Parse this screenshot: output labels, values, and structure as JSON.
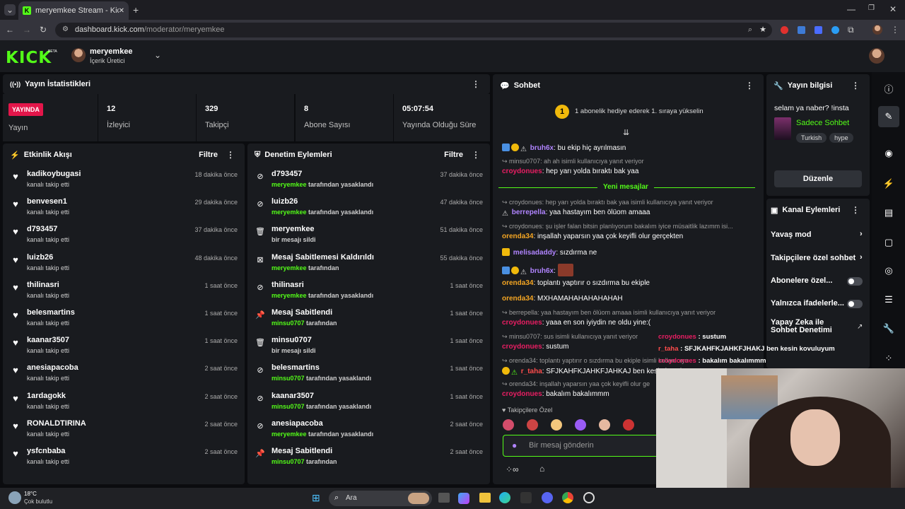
{
  "browser": {
    "tab_title": "meryemkee Stream - Kick Dash",
    "url_domain": "dashboard.kick.com",
    "url_path": "/moderator/meryemkee"
  },
  "header": {
    "logo": "KICK",
    "beta": "BETA",
    "username": "meryemkee",
    "role": "İçerik Üretici"
  },
  "stats": {
    "title": "Yayın İstatistikleri",
    "live_label": "YAYINDA",
    "live_sub": "Yayın",
    "items": [
      {
        "value": "12",
        "label": "İzleyici"
      },
      {
        "value": "329",
        "label": "Takipçi"
      },
      {
        "value": "8",
        "label": "Abone Sayısı"
      },
      {
        "value": "05:07:54",
        "label": "Yayında Olduğu Süre"
      }
    ]
  },
  "activity": {
    "title": "Etkinlik Akışı",
    "filter": "Filtre",
    "items": [
      {
        "name": "kadikoybugasi",
        "sub": "kanalı takip etti",
        "time": "18 dakika önce"
      },
      {
        "name": "benvesen1",
        "sub": "kanalı takip etti",
        "time": "29 dakika önce"
      },
      {
        "name": "d793457",
        "sub": "kanalı takip etti",
        "time": "37 dakika önce"
      },
      {
        "name": "luizb26",
        "sub": "kanalı takip etti",
        "time": "48 dakika önce"
      },
      {
        "name": "thilinasri",
        "sub": "kanalı takip etti",
        "time": "1 saat önce"
      },
      {
        "name": "belesmartins",
        "sub": "kanalı takip etti",
        "time": "1 saat önce"
      },
      {
        "name": "kaanar3507",
        "sub": "kanalı takip etti",
        "time": "1 saat önce"
      },
      {
        "name": "anesiapacoba",
        "sub": "kanalı takip etti",
        "time": "2 saat önce"
      },
      {
        "name": "1ardagokk",
        "sub": "kanalı takip etti",
        "time": "2 saat önce"
      },
      {
        "name": "RONALDTIRINA",
        "sub": "kanalı takip etti",
        "time": "2 saat önce"
      },
      {
        "name": "ysfcnbaba",
        "sub": "kanalı takip etti",
        "time": "2 saat önce"
      }
    ]
  },
  "moderation": {
    "title": "Denetim Eylemleri",
    "filter": "Filtre",
    "items": [
      {
        "icon": "ban",
        "name": "d793457",
        "by": "meryemkee",
        "sub": " tarafından yasaklandı",
        "time": "37 dakika önce"
      },
      {
        "icon": "ban",
        "name": "luizb26",
        "by": "meryemkee",
        "sub": " tarafından yasaklandı",
        "time": "47 dakika önce"
      },
      {
        "icon": "trash",
        "name": "meryemkee",
        "by": "",
        "sub": "bir mesajı sildi",
        "time": "51 dakika önce"
      },
      {
        "icon": "unpin",
        "name": "Mesaj Sabitlemesi Kaldırıldı",
        "by": "meryemkee",
        "sub": " tarafından",
        "time": "55 dakika önce"
      },
      {
        "icon": "ban",
        "name": "thilinasri",
        "by": "meryemkee",
        "sub": " tarafından yasaklandı",
        "time": "1 saat önce"
      },
      {
        "icon": "pin",
        "name": "Mesaj Sabitlendi",
        "by": "minsu0707",
        "sub": " tarafından",
        "time": "1 saat önce"
      },
      {
        "icon": "trash",
        "name": "minsu0707",
        "by": "",
        "sub": "bir mesajı sildi",
        "time": "1 saat önce"
      },
      {
        "icon": "ban",
        "name": "belesmartins",
        "by": "minsu0707",
        "sub": " tarafından yasaklandı",
        "time": "1 saat önce"
      },
      {
        "icon": "ban",
        "name": "kaanar3507",
        "by": "minsu0707",
        "sub": " tarafından yasaklandı",
        "time": "1 saat önce"
      },
      {
        "icon": "ban",
        "name": "anesiapacoba",
        "by": "meryemkee",
        "sub": " tarafından yasaklandı",
        "time": "2 saat önce"
      },
      {
        "icon": "pin",
        "name": "Mesaj Sabitlendi",
        "by": "minsu0707",
        "sub": " tarafından",
        "time": "2 saat önce"
      }
    ]
  },
  "chat": {
    "title": "Sohbet",
    "gift": "1 abonelik hediye ederek 1. sıraya yükselin",
    "new_messages": "Yeni mesajlar",
    "placeholder": "Bir mesaj gönderin",
    "followers_only": "Takipçilere Özel",
    "lines": [
      {
        "reply": "",
        "user": "bruh6x",
        "color": "purple",
        "text": ": bu ekip hiç ayrılmasın"
      },
      {
        "reply": "minsu0707: ah ah isimli kullanıcıya yanıt veriyor",
        "user": "croydonues",
        "color": "pink",
        "text": ": hep yarı yolda bıraktı bak yaa"
      },
      {
        "reply": "croydonues: hep yarı yolda bıraktı bak yaa isimli kullanıcıya yanıt veriyor",
        "user": "berrepella",
        "color": "purple",
        "text": ": yaa hastayım ben ölüom amaaa"
      },
      {
        "reply": "croydonues: şu işler falan bitsin planlıyorum bakalım iyice müsaitlik lazımm isi...",
        "user": "orenda34",
        "color": "orange",
        "text": ": inşallah yaparsın yaa çok keyifli olur gerçekten"
      },
      {
        "reply": "",
        "user": "melisadaddy",
        "color": "purple",
        "text": ": sızdırma ne"
      },
      {
        "reply": "",
        "user": "bruh6x",
        "color": "purple",
        "text": ":"
      },
      {
        "reply": "",
        "user": "orenda34",
        "color": "orange",
        "text": ": toplantı yaptırır o sızdırma bu ekiple"
      },
      {
        "reply": "",
        "user": "orenda34",
        "color": "orange",
        "text": ": MXHAMAHAHAHAHAHAH"
      },
      {
        "reply": "berrepella: yaa hastayım ben ölüom amaaa isimli kullanıcıya yanıt veriyor",
        "user": "croydonues",
        "color": "pink",
        "text": ": yaaa en son iyiydin ne oldu yine:("
      },
      {
        "reply": "minsu0707: sus isimli kullanıcıya yanıt veriyor",
        "user": "croydonues",
        "color": "pink",
        "text": ": sustum"
      },
      {
        "reply": "orenda34: toplantı yaptırır o sızdırma bu ekiple isimli kullanıcıya",
        "user": "r_taha",
        "color": "red",
        "text": ": SFJKAHFKJAHKFJAHKAJ ben kesin kovuluyum"
      },
      {
        "reply": "orenda34: inşallah yaparsın yaa çok keyifli olur ge",
        "user": "croydonues",
        "color": "pink",
        "text": ": bakalım bakalımmm"
      }
    ]
  },
  "overlay": {
    "l1u": "croydonues",
    "l1t": " : sustum",
    "l2u": "r_taha",
    "l2t": " : SFJKAHFKJAHKFJHAKJ ben kesin kovuluyum",
    "l3u": "croydonues",
    "l3t": " : bakalım bakalımmm"
  },
  "info": {
    "title": "Yayın bilgisi",
    "stream_title": "selam ya naber? !insta",
    "category": "Sadece Sohbet",
    "tags": [
      "Turkish",
      "hype"
    ],
    "edit": "Düzenle"
  },
  "channel_actions": {
    "title": "Kanal Eylemleri",
    "items": [
      "Yavaş mod",
      "Takipçilere özel sohbet",
      "Abonelere özel...",
      "Yalnızca ifadelerle...",
      "Yapay Zeka ile Sohbet Denetimi"
    ]
  },
  "taskbar": {
    "temp": "18°C",
    "weather": "Çok bulutlu",
    "search": "Ara"
  }
}
